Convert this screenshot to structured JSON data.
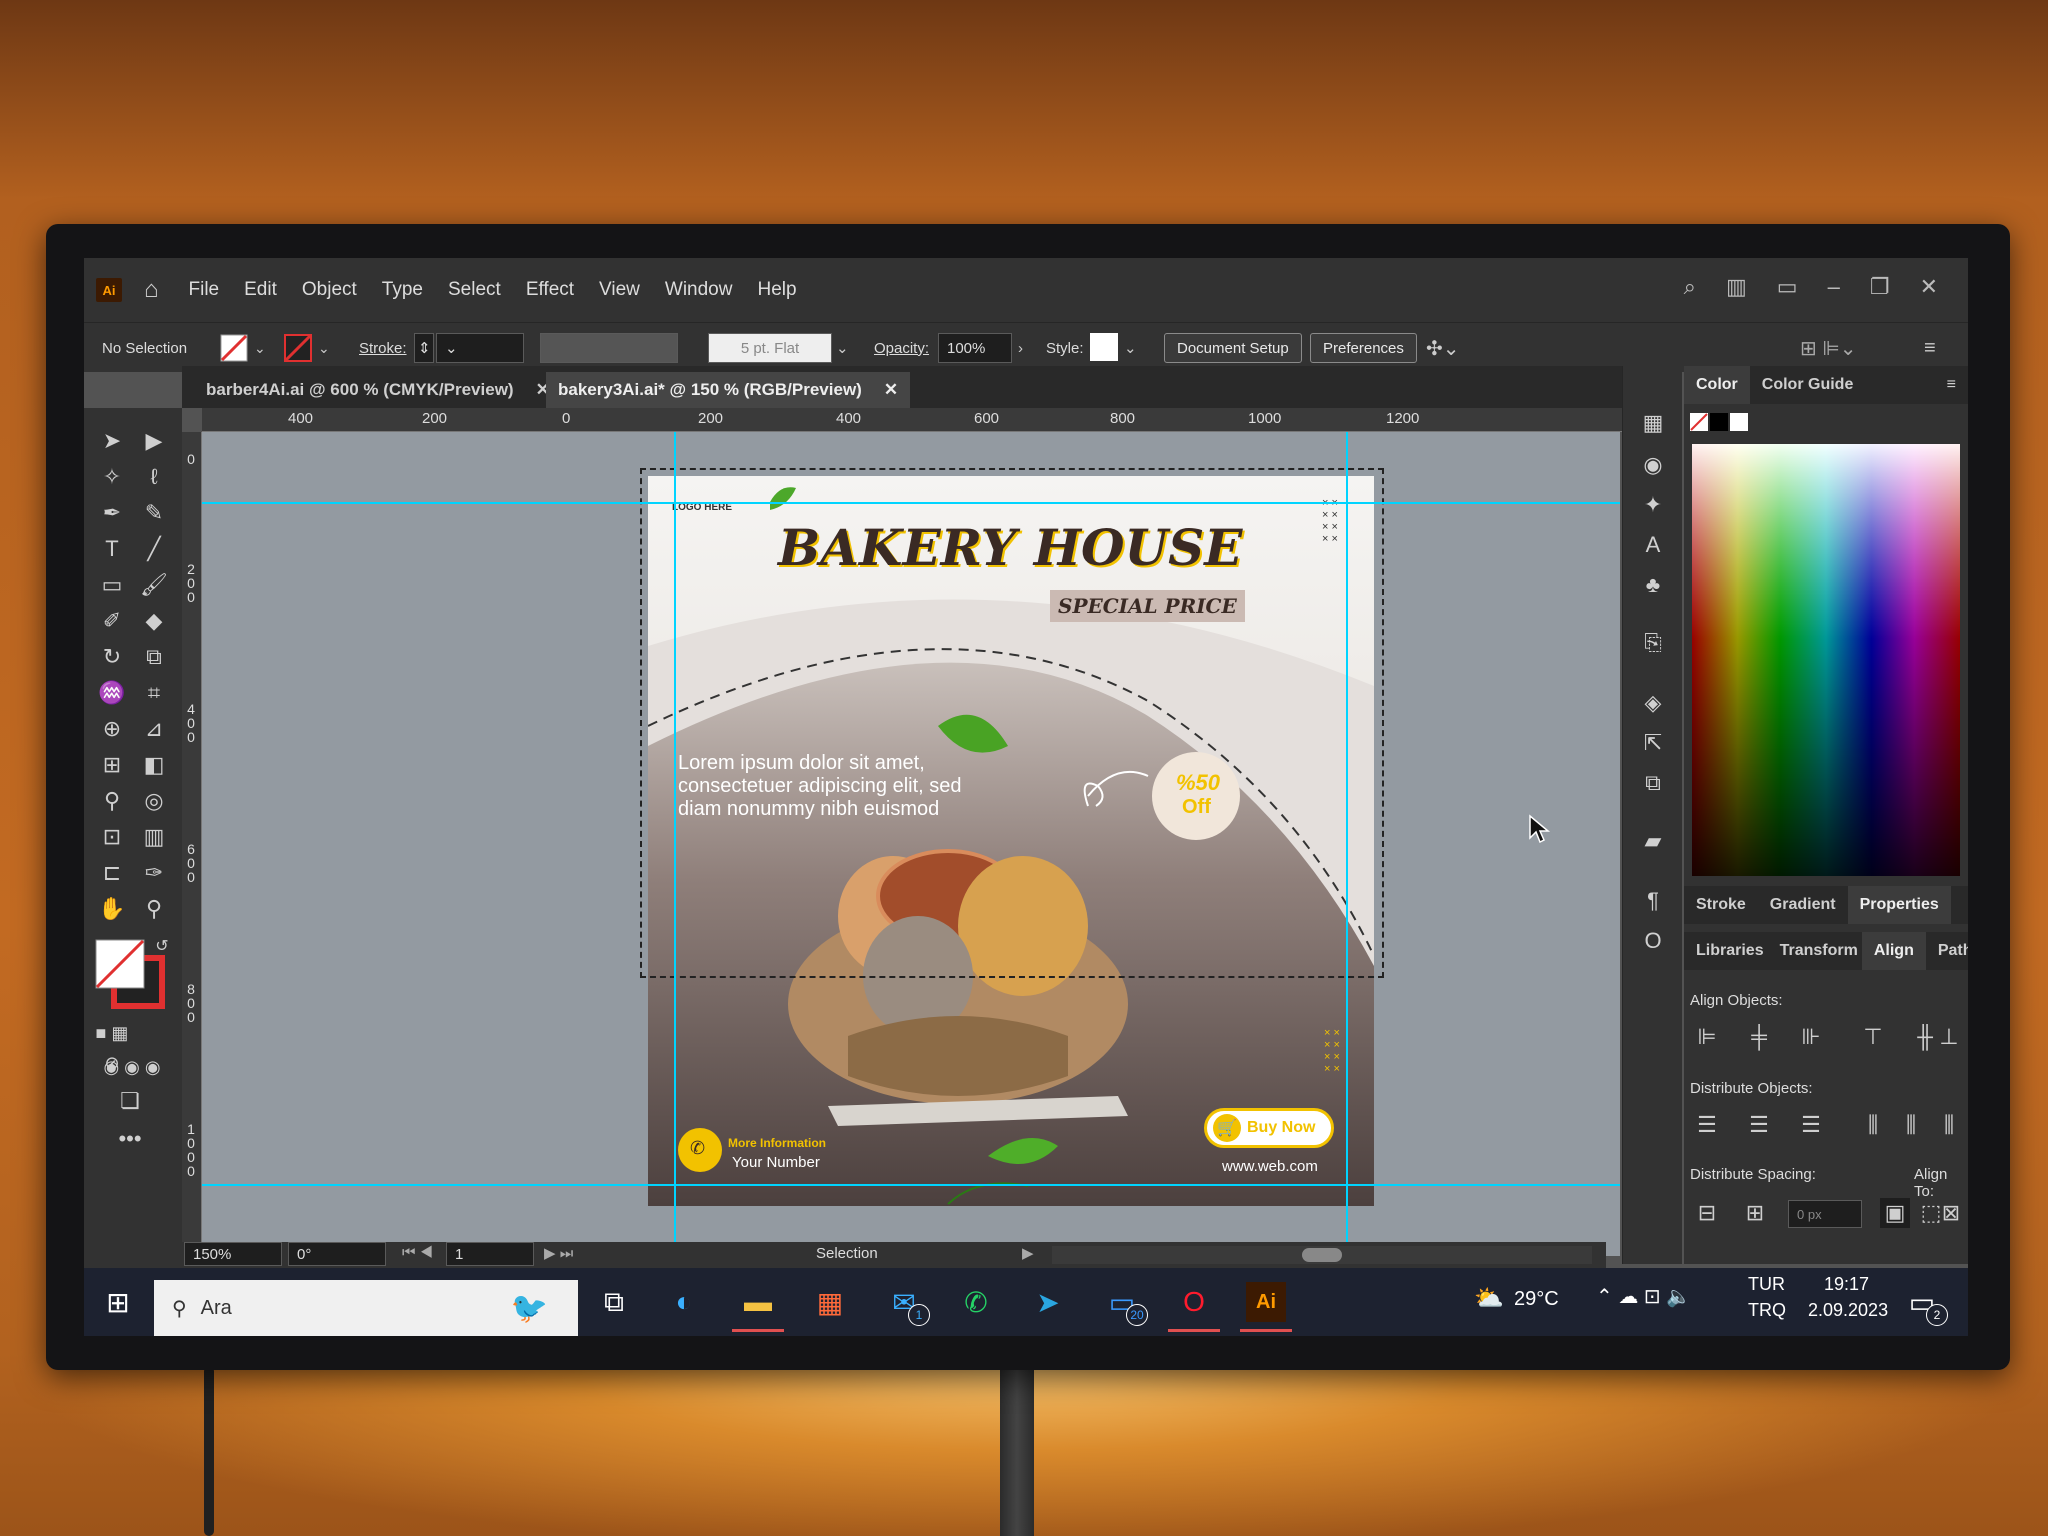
{
  "app": {
    "badge": "Ai",
    "menu": [
      "File",
      "Edit",
      "Object",
      "Type",
      "Select",
      "Effect",
      "View",
      "Window",
      "Help"
    ]
  },
  "control": {
    "selection": "No Selection",
    "stroke_label": "Stroke:",
    "brush": "5 pt. Flat",
    "opacity_label": "Opacity:",
    "opacity": "100%",
    "style_label": "Style:",
    "doc_setup": "Document Setup",
    "preferences": "Preferences"
  },
  "tabs": [
    {
      "label": "barber4Ai.ai @ 600 % (CMYK/Preview)"
    },
    {
      "label": "bakery3Ai.ai* @ 150 % (RGB/Preview)"
    }
  ],
  "ruler": {
    "h": [
      "400",
      "200",
      "0",
      "200",
      "400",
      "600",
      "800",
      "1000",
      "1200"
    ],
    "v": [
      "0",
      "200",
      "400",
      "600",
      "800",
      "1000"
    ]
  },
  "artboard": {
    "logo": "LOGO HERE",
    "title": "BAKERY HOUSE",
    "subtitle": "SPECIAL PRICE",
    "body": "Lorem ipsum dolor sit amet, consectetuer adipiscing elit, sed diam nonummy nibh euismod",
    "discount_line1": "%50",
    "discount_line2": "Off",
    "more_info": "More Information",
    "number": "Your Number",
    "buy_now": "Buy Now",
    "website": "www.web.com"
  },
  "status": {
    "zoom": "150%",
    "angle": "0°",
    "page": "1",
    "tool": "Selection"
  },
  "panel": {
    "tabs_top": [
      "Color",
      "Color Guide"
    ],
    "tabs_mid": [
      "Stroke",
      "Gradient",
      "Properties"
    ],
    "tabs_low": [
      "Libraries",
      "Transform",
      "Align",
      "Pathfinde"
    ],
    "align_objects": "Align Objects:",
    "distribute_objects": "Distribute Objects:",
    "distribute_spacing": "Distribute Spacing:",
    "spacing_value": "0 px",
    "align_to": "Align To:"
  },
  "taskbar": {
    "search": "Ara",
    "mail_badge": "1",
    "phone_badge": "20",
    "weather": "29°C",
    "lang1": "TUR",
    "lang2": "TRQ",
    "time": "19:17",
    "date": "2.09.2023",
    "notif_badge": "2"
  },
  "colors": {
    "accent": "#00d4ff",
    "buy": "#f2c200",
    "ai_orange": "#ff9a00"
  }
}
